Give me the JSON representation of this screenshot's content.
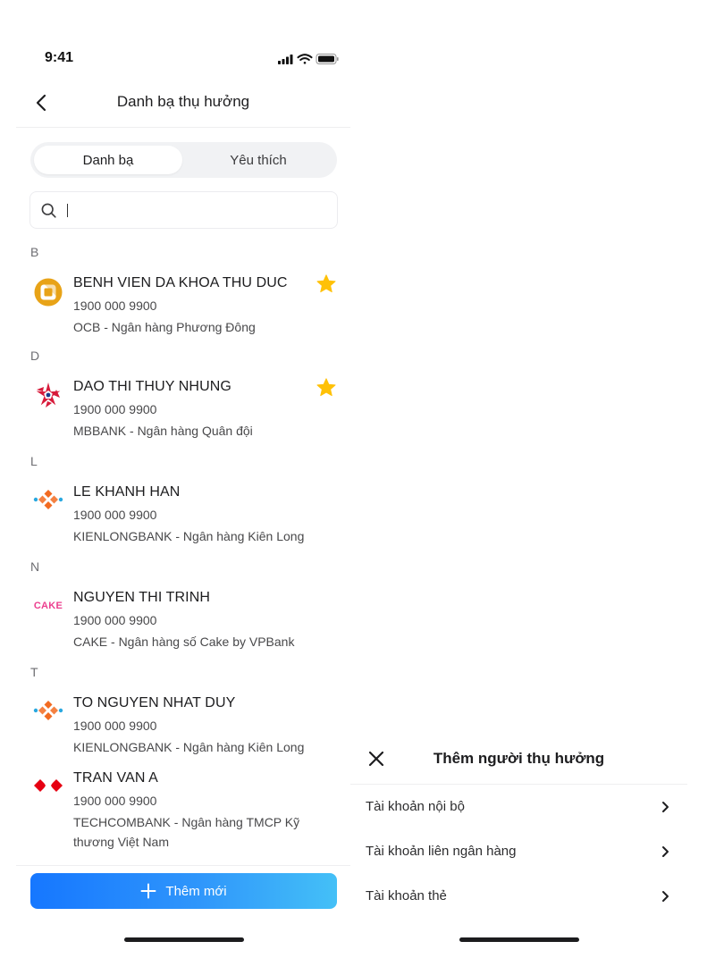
{
  "status_bar": {
    "time": "9:41"
  },
  "header": {
    "title": "Danh bạ thụ hưởng"
  },
  "segments": {
    "contacts": "Danh bạ",
    "favorites": "Yêu thích"
  },
  "search": {
    "value": "",
    "placeholder": ""
  },
  "sections": [
    {
      "letter": "B",
      "contacts": [
        {
          "name": "BENH VIEN DA KHOA THU DUC",
          "phone": "1900 000 9900",
          "bank": "OCB - Ngân hàng Phương Đông",
          "favorite": true,
          "logo": "ocb-logo"
        }
      ]
    },
    {
      "letter": "D",
      "contacts": [
        {
          "name": "DAO THI THUY NHUNG",
          "phone": "1900 000 9900",
          "bank": "MBBANK - Ngân hàng Quân đội",
          "favorite": true,
          "logo": "mbbank-logo"
        }
      ]
    },
    {
      "letter": "L",
      "contacts": [
        {
          "name": "LE KHANH HAN",
          "phone": "1900 000 9900",
          "bank": "KIENLONGBANK - Ngân hàng Kiên Long",
          "favorite": false,
          "logo": "kienlongbank-logo"
        }
      ]
    },
    {
      "letter": "N",
      "contacts": [
        {
          "name": "NGUYEN THI TRINH",
          "phone": "1900 000 9900",
          "bank": "CAKE - Ngân hàng số Cake by VPBank",
          "favorite": false,
          "logo": "cake-logo",
          "logo_text": "CAKE"
        }
      ]
    },
    {
      "letter": "T",
      "contacts": [
        {
          "name": "TO NGUYEN NHAT DUY",
          "phone": "1900 000 9900",
          "bank": "KIENLONGBANK - Ngân hàng Kiên Long",
          "favorite": false,
          "logo": "kienlongbank-logo"
        },
        {
          "name": "TRAN VAN A",
          "phone": "1900 000 9900",
          "bank": "TECHCOMBANK - Ngân hàng TMCP Kỹ thương Việt Nam",
          "favorite": false,
          "logo": "techcombank-logo"
        }
      ]
    }
  ],
  "add_button": {
    "label": "Thêm mới"
  },
  "add_sheet": {
    "title": "Thêm người thụ hưởng",
    "options": [
      {
        "label": "Tài khoản nội bộ"
      },
      {
        "label": "Tài khoản liên ngân hàng"
      },
      {
        "label": "Tài khoản thẻ"
      }
    ]
  },
  "colors": {
    "primary": "#1677ff",
    "gradient_end": "#44c0f7",
    "star": "#ffc107",
    "ocb": "#e8a317",
    "mbbank": "#d71a3a",
    "kienlong_orange": "#f26b21",
    "kienlong_blue": "#29a8e0",
    "cake": "#ec3f8f",
    "techcombank": "#e60012"
  }
}
